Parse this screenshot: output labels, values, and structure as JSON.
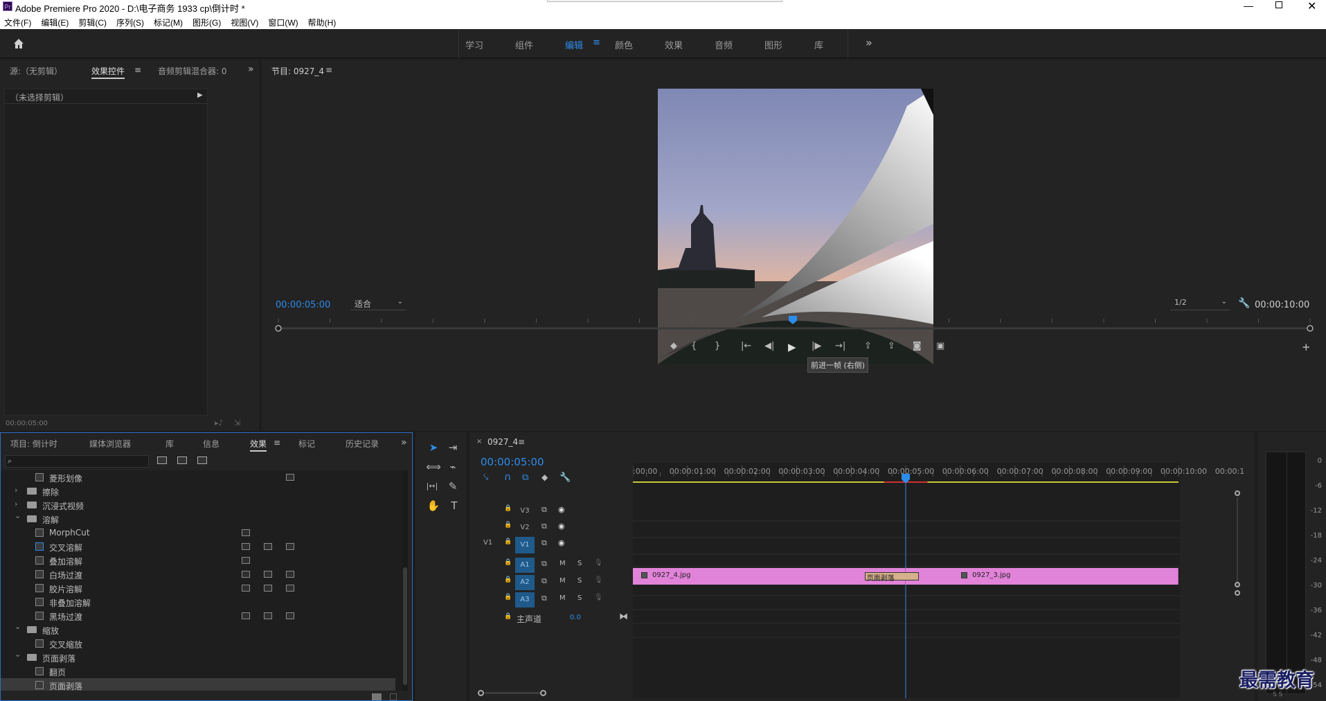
{
  "app": {
    "title": "Adobe Premiere Pro 2020 - D:\\电子商务 1933 cp\\倒计时 *",
    "logo": "Pr",
    "window_controls": [
      "minimize-icon",
      "restore-icon",
      "close-icon"
    ]
  },
  "menu": [
    "文件(F)",
    "编辑(E)",
    "剪辑(C)",
    "序列(S)",
    "标记(M)",
    "图形(G)",
    "视图(V)",
    "窗口(W)",
    "帮助(H)"
  ],
  "workspaces": {
    "tabs": [
      "学习",
      "组件",
      "编辑",
      "颜色",
      "效果",
      "音频",
      "图形",
      "库"
    ],
    "active": "编辑",
    "more": "»"
  },
  "source_panel": {
    "tabs": [
      "源:（无剪辑）",
      "效果控件",
      "音频剪辑混合器: 0"
    ],
    "active_tab": "效果控件",
    "no_clip": "（未选择剪辑）",
    "timecode": "00:00:05:00"
  },
  "program_monitor": {
    "title": "节目: 0927_4",
    "timecode": "00:00:05:00",
    "fit": "适合",
    "resolution": "1/2",
    "duration": "00:00:10:00",
    "tooltip": "前进一帧 (右侧)",
    "playhead_fraction": 0.5
  },
  "project_panel": {
    "tabs": [
      "项目: 倒计时",
      "媒体浏览器",
      "库",
      "信息",
      "效果",
      "标记",
      "历史记录"
    ],
    "active_tab": "效果",
    "search_placeholder": "",
    "items": [
      {
        "level": 2,
        "type": "effect",
        "label": "菱形划像",
        "badges": 1
      },
      {
        "level": 1,
        "type": "folder",
        "label": "擦除",
        "expanded": false
      },
      {
        "level": 1,
        "type": "folder",
        "label": "沉浸式视频",
        "expanded": false
      },
      {
        "level": 1,
        "type": "folder",
        "label": "溶解",
        "expanded": true
      },
      {
        "level": 2,
        "type": "effect",
        "label": "MorphCut",
        "badges": 1
      },
      {
        "level": 2,
        "type": "effect",
        "label": "交叉溶解",
        "badges": 3
      },
      {
        "level": 2,
        "type": "effect",
        "label": "叠加溶解",
        "badges": 1
      },
      {
        "level": 2,
        "type": "effect",
        "label": "白场过渡",
        "badges": 3
      },
      {
        "level": 2,
        "type": "effect",
        "label": "胶片溶解",
        "badges": 3
      },
      {
        "level": 2,
        "type": "effect",
        "label": "非叠加溶解",
        "badges": 0
      },
      {
        "level": 2,
        "type": "effect",
        "label": "黑场过渡",
        "badges": 3
      },
      {
        "level": 1,
        "type": "folder",
        "label": "缩放",
        "expanded": true
      },
      {
        "level": 2,
        "type": "effect",
        "label": "交叉缩放",
        "badges": 0
      },
      {
        "level": 1,
        "type": "folder",
        "label": "页面剥落",
        "expanded": true
      },
      {
        "level": 2,
        "type": "effect",
        "label": "翻页",
        "badges": 0
      },
      {
        "level": 2,
        "type": "effect",
        "label": "页面剥落",
        "badges": 0,
        "selected": true
      }
    ]
  },
  "timeline": {
    "sequence": "0927_4",
    "timecode": "00:00:05:00",
    "ruler": [
      ":00:00",
      "00:00:01:00",
      "00:00:02:00",
      "00:00:03:00",
      "00:00:04:00",
      "00:00:05:00",
      "00:00:06:00",
      "00:00:07:00",
      "00:00:08:00",
      "00:00:09:00",
      "00:00:10:00",
      "00:00:1"
    ],
    "tracks": {
      "video": [
        "V3",
        "V2",
        "V1"
      ],
      "audio": [
        "A1",
        "A2",
        "A3"
      ],
      "source_patch": "V1",
      "master_label": "主声道",
      "master_value": "0.0",
      "audio_buttons": [
        "M",
        "S"
      ]
    },
    "clips": [
      {
        "name": "0927_4.jpg",
        "start": 0,
        "end": 5
      },
      {
        "name": "0927_3.jpg",
        "start": 5,
        "end": 10
      }
    ],
    "transition": {
      "name": "页面剥落",
      "start": 4.5,
      "end": 5.5
    },
    "playhead_seconds": 5
  },
  "meter": {
    "labels": [
      "0",
      "-6",
      "-12",
      "-18",
      "-24",
      "-30",
      "-36",
      "-42",
      "-48",
      "-54"
    ],
    "bottom": "S S"
  },
  "watermark": "最需教育",
  "colors": {
    "accent": "#2d8ceb",
    "clip": "#e183d8",
    "transition": "#d6b08a",
    "work_area": "#c8c83a",
    "render_red": "#d03030"
  }
}
